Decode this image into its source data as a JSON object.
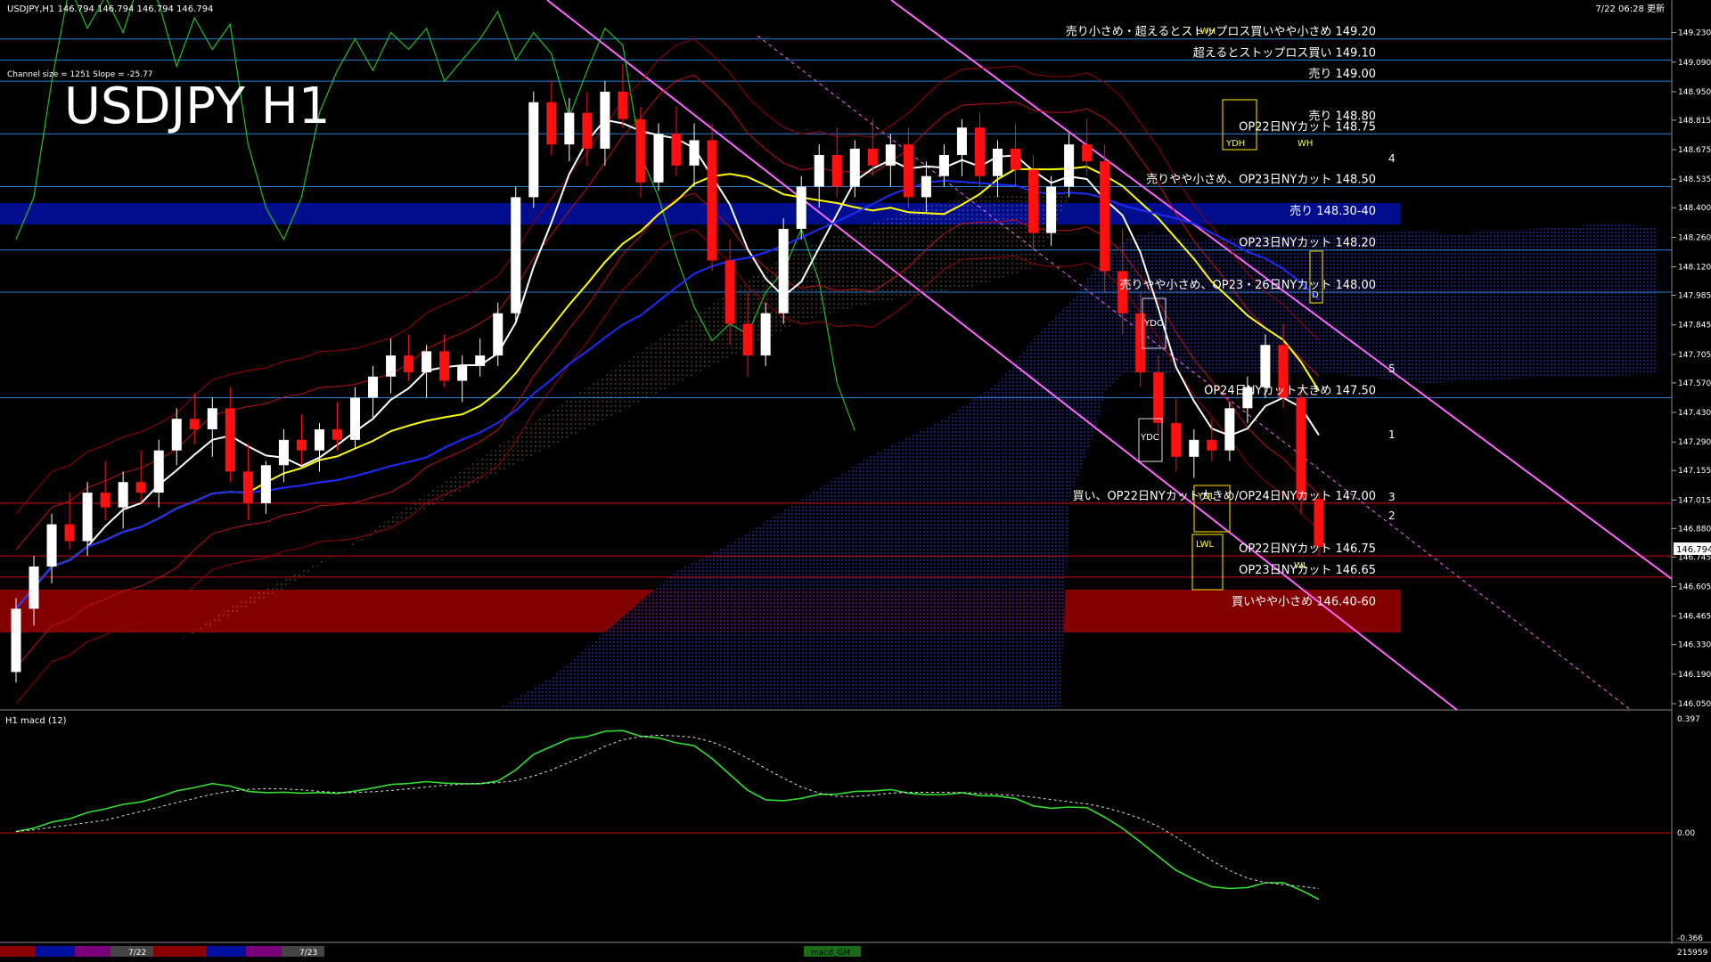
{
  "header": {
    "symbol_info": "USDJPY,H1  146.794 146.794 146.794 146.794",
    "updated": "7/22 06:28 更新",
    "channel_info": "Channel size = 1251 Slope = -25.77",
    "big_title": "USDJPY H1"
  },
  "macd_panel": {
    "label": "H1  macd (12)",
    "top_value": "0.397",
    "zero_value": "0.00",
    "bottom_value": "-0.366"
  },
  "bottom_bar": {
    "date1": "7/22",
    "date2": "7/23",
    "tab": "macd_GM",
    "counter": "215959"
  },
  "colors": {
    "background": "#000000",
    "bull_candle": "#ffffff",
    "bear_candle": "#ff1010",
    "ma_white": "#ffffff",
    "ma_yellow": "#ffff00",
    "ma_blue": "#1c2cff",
    "lagging_span": "#20c020",
    "channel": "#ff66ff",
    "sell_zone": "#000f9c",
    "buy_zone": "#8a0000",
    "macd_up": "#30e030",
    "macd_down": "#ff8a9a",
    "level_line": "#2a7fd6",
    "level_line_red": "#d01010"
  },
  "annotations": [
    {
      "text": "売り小さめ・超えるとストップロス買いやや小さめ 149.20",
      "price": 149.2
    },
    {
      "text": "超えるとストップロス買い 149.10",
      "price": 149.1
    },
    {
      "text": "売り 149.00",
      "price": 149.0
    },
    {
      "text": "売り 148.80",
      "price": 148.8
    },
    {
      "text": "OP22日NYカット 148.75",
      "price": 148.75
    },
    {
      "text": "売りやや小さめ、OP23日NYカット 148.50",
      "price": 148.5
    },
    {
      "text": "売り 148.30-40",
      "price": 148.35
    },
    {
      "text": "OP23日NYカット 148.20",
      "price": 148.2
    },
    {
      "text": "売りやや小さめ、OP23・26日NYカット 148.00",
      "price": 148.0
    },
    {
      "text": "OP24日NYカット大きめ 147.50",
      "price": 147.5
    },
    {
      "text": "買い、OP22日NYカット大きめ/OP24日NYカット 147.00",
      "price": 147.0
    },
    {
      "text": "OP22日NYカット 146.75",
      "price": 146.75
    },
    {
      "text": "OP23日NYカット 146.65",
      "price": 146.65
    },
    {
      "text": "買いやや小さめ 146.40-60",
      "price": 146.5
    }
  ],
  "box_labels": [
    "YDH",
    "YDO",
    "YDC",
    "YDL",
    "LWL",
    "LWH",
    "WH",
    "WL",
    "D"
  ],
  "channel_numbers": [
    "4",
    "5",
    "1",
    "3",
    "2"
  ],
  "price_ticks": [
    "149.230",
    "149.090",
    "148.950",
    "148.815",
    "148.675",
    "148.535",
    "148.400",
    "148.260",
    "148.120",
    "147.985",
    "147.845",
    "147.705",
    "147.570",
    "147.430",
    "147.290",
    "147.155",
    "147.015",
    "146.880",
    "146.745",
    "146.605",
    "146.465",
    "146.330",
    "146.190",
    "146.050"
  ],
  "current_price": "146.794",
  "chart_data": {
    "type": "candlestick",
    "symbol": "USDJPY",
    "timeframe": "H1",
    "y_range": [
      146.05,
      149.3
    ],
    "last": 146.794,
    "support_zone": [
      146.4,
      146.6
    ],
    "resistance_zone": [
      148.3,
      148.4
    ],
    "candles": [
      [
        146.2,
        146.55,
        146.15,
        146.5
      ],
      [
        146.5,
        146.75,
        146.42,
        146.7
      ],
      [
        146.7,
        146.95,
        146.62,
        146.9
      ],
      [
        146.9,
        147.05,
        146.78,
        146.82
      ],
      [
        146.82,
        147.1,
        146.75,
        147.05
      ],
      [
        147.05,
        147.2,
        146.92,
        146.98
      ],
      [
        146.98,
        147.15,
        146.88,
        147.1
      ],
      [
        147.1,
        147.25,
        147.0,
        147.05
      ],
      [
        147.05,
        147.3,
        146.98,
        147.25
      ],
      [
        147.25,
        147.45,
        147.18,
        147.4
      ],
      [
        147.4,
        147.52,
        147.28,
        147.35
      ],
      [
        147.35,
        147.5,
        147.22,
        147.45
      ],
      [
        147.45,
        147.55,
        147.1,
        147.15
      ],
      [
        147.15,
        147.28,
        146.92,
        147.0
      ],
      [
        147.0,
        147.2,
        146.95,
        147.18
      ],
      [
        147.18,
        147.35,
        147.1,
        147.3
      ],
      [
        147.3,
        147.42,
        147.18,
        147.25
      ],
      [
        147.25,
        147.38,
        147.15,
        147.35
      ],
      [
        147.35,
        147.48,
        147.25,
        147.3
      ],
      [
        147.3,
        147.55,
        147.26,
        147.5
      ],
      [
        147.5,
        147.65,
        147.4,
        147.6
      ],
      [
        147.6,
        147.78,
        147.52,
        147.7
      ],
      [
        147.7,
        147.8,
        147.58,
        147.62
      ],
      [
        147.62,
        147.75,
        147.5,
        147.72
      ],
      [
        147.72,
        147.8,
        147.55,
        147.58
      ],
      [
        147.58,
        147.7,
        147.48,
        147.65
      ],
      [
        147.65,
        147.78,
        147.6,
        147.7
      ],
      [
        147.7,
        147.95,
        147.65,
        147.9
      ],
      [
        147.9,
        148.5,
        147.85,
        148.45
      ],
      [
        148.45,
        148.95,
        148.4,
        148.9
      ],
      [
        148.9,
        149.0,
        148.65,
        148.7
      ],
      [
        148.7,
        148.92,
        148.62,
        148.85
      ],
      [
        148.85,
        148.95,
        148.6,
        148.68
      ],
      [
        148.68,
        149.0,
        148.6,
        148.95
      ],
      [
        148.95,
        149.08,
        148.78,
        148.82
      ],
      [
        148.82,
        148.88,
        148.45,
        148.52
      ],
      [
        148.52,
        148.8,
        148.48,
        148.75
      ],
      [
        148.75,
        148.88,
        148.55,
        148.6
      ],
      [
        148.6,
        148.8,
        148.5,
        148.72
      ],
      [
        148.72,
        148.8,
        148.1,
        148.15
      ],
      [
        148.15,
        148.25,
        147.75,
        147.85
      ],
      [
        147.85,
        148.0,
        147.6,
        147.7
      ],
      [
        147.7,
        147.95,
        147.65,
        147.9
      ],
      [
        147.9,
        148.35,
        147.85,
        148.3
      ],
      [
        148.3,
        148.55,
        148.25,
        148.5
      ],
      [
        148.5,
        148.7,
        148.4,
        148.65
      ],
      [
        148.65,
        148.78,
        148.45,
        148.5
      ],
      [
        148.5,
        148.72,
        148.45,
        148.68
      ],
      [
        148.68,
        148.82,
        148.55,
        148.6
      ],
      [
        148.6,
        148.75,
        148.5,
        148.7
      ],
      [
        148.7,
        148.78,
        148.4,
        148.45
      ],
      [
        148.45,
        148.62,
        148.38,
        148.55
      ],
      [
        148.55,
        148.7,
        148.5,
        148.65
      ],
      [
        148.65,
        148.82,
        148.55,
        148.78
      ],
      [
        148.78,
        148.85,
        148.5,
        148.55
      ],
      [
        148.55,
        148.72,
        148.45,
        148.68
      ],
      [
        148.68,
        148.8,
        148.5,
        148.58
      ],
      [
        148.58,
        148.65,
        148.2,
        148.28
      ],
      [
        148.28,
        148.55,
        148.22,
        148.5
      ],
      [
        148.5,
        148.75,
        148.45,
        148.7
      ],
      [
        148.7,
        148.82,
        148.55,
        148.62
      ],
      [
        148.62,
        148.7,
        148.0,
        148.1
      ],
      [
        148.1,
        148.3,
        147.8,
        147.9
      ],
      [
        147.9,
        148.0,
        147.55,
        147.62
      ],
      [
        147.62,
        147.7,
        147.3,
        147.38
      ],
      [
        147.38,
        147.5,
        147.15,
        147.22
      ],
      [
        147.22,
        147.35,
        147.12,
        147.3
      ],
      [
        147.3,
        147.4,
        147.2,
        147.25
      ],
      [
        147.25,
        147.48,
        147.2,
        147.45
      ],
      [
        147.45,
        147.6,
        147.38,
        147.55
      ],
      [
        147.55,
        147.8,
        147.5,
        147.75
      ],
      [
        147.75,
        147.85,
        147.45,
        147.5
      ],
      [
        147.5,
        147.55,
        146.95,
        147.02
      ],
      [
        147.02,
        147.05,
        146.75,
        146.794
      ]
    ]
  }
}
